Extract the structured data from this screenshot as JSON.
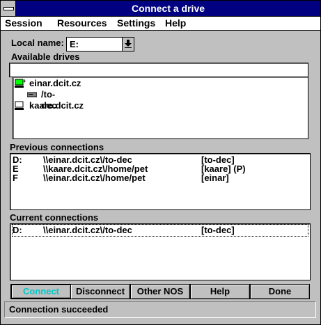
{
  "window": {
    "title": "Connect a drive"
  },
  "menu": [
    "Session",
    "Resources",
    "Settings",
    "Help"
  ],
  "local_name": {
    "label": "Local name:",
    "value": "E:"
  },
  "available": {
    "label": "Available drives",
    "path_value": "",
    "items": [
      {
        "label": "einar.dcit.cz",
        "icon": "computer-icon",
        "expanded": true
      },
      {
        "label": "/to-dec",
        "icon": "drive-icon"
      },
      {
        "label": "kaare.dcit.cz",
        "icon": "computer-icon"
      }
    ]
  },
  "previous": {
    "label": "Previous connections",
    "rows": [
      {
        "drive": "D:",
        "path": "\\\\einar.dcit.cz\\/to-dec",
        "tag": "[to-dec]"
      },
      {
        "drive": "E",
        "path": "\\\\kaare.dcit.cz\\/home/pet",
        "tag": "[kaare] (P)"
      },
      {
        "drive": "F",
        "path": "\\\\einar.dcit.cz\\/home/pet",
        "tag": "[einar]"
      }
    ]
  },
  "current": {
    "label": "Current connections",
    "rows": [
      {
        "drive": "D:",
        "path": "\\\\einar.dcit.cz\\/to-dec",
        "tag": "[to-dec]"
      }
    ]
  },
  "buttons": [
    "Connect",
    "Disconnect",
    "Other NOS",
    "Help",
    "Done"
  ],
  "status": "Connection succeeded",
  "colors": {
    "titlebar": "#000080",
    "disabled_text": "#00c8c8"
  }
}
